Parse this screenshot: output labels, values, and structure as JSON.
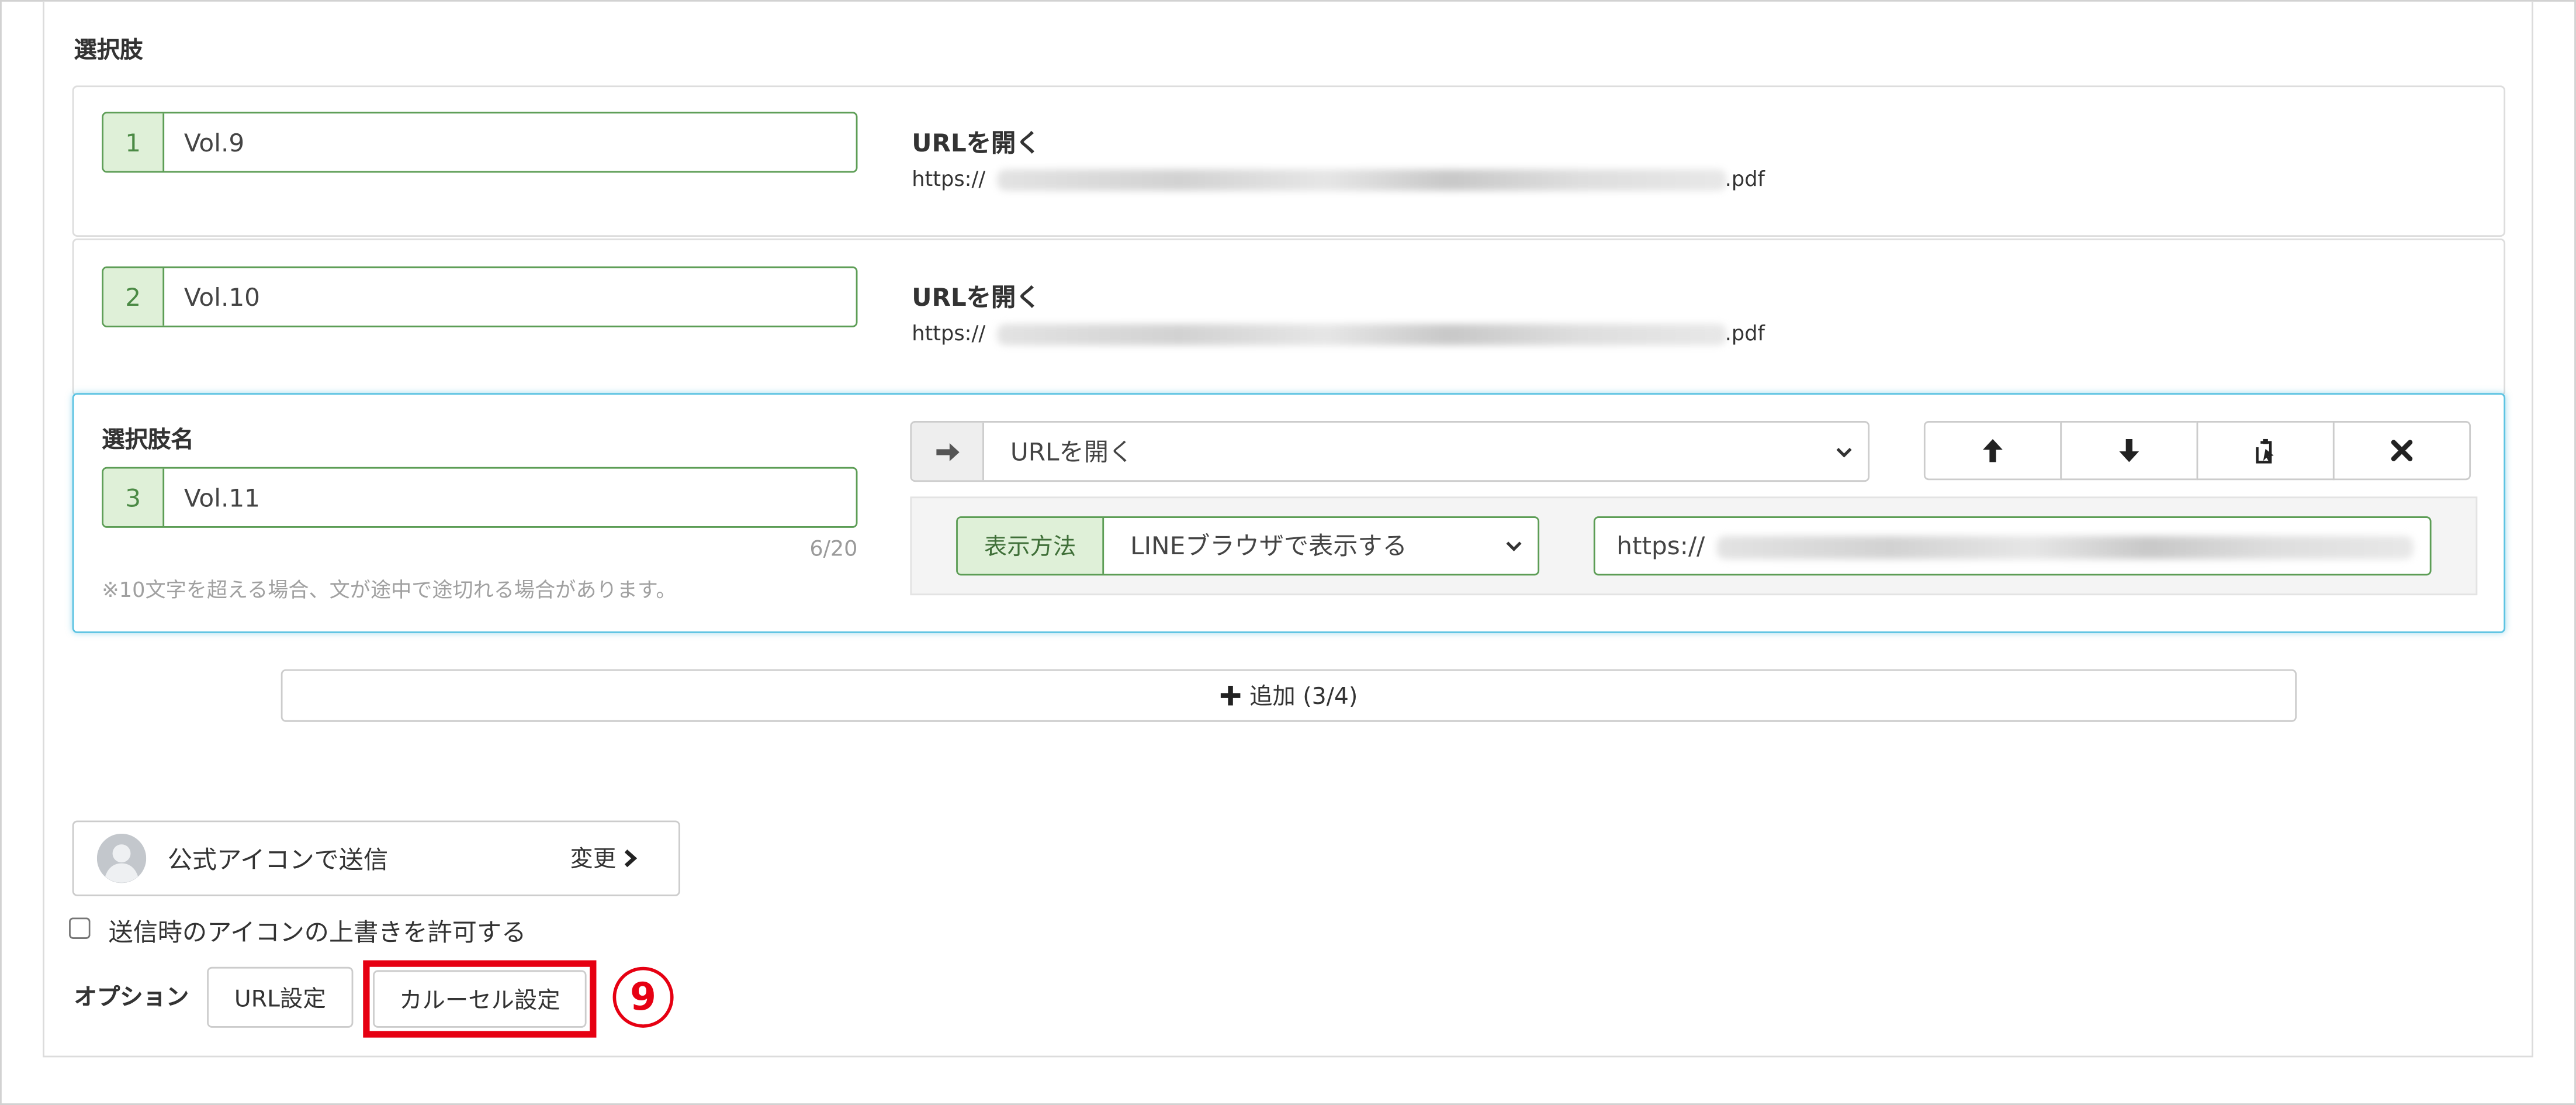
{
  "section_label": "選択肢",
  "choices": [
    {
      "index": "1",
      "label": "Vol.9",
      "action": "URLを開く",
      "url_prefix": "https://",
      "url_suffix": ".pdf"
    },
    {
      "index": "2",
      "label": "Vol.10",
      "action": "URLを開く",
      "url_prefix": "https://",
      "url_suffix": ".pdf"
    }
  ],
  "active_choice": {
    "field_label": "選択肢名",
    "index": "3",
    "label": "Vol.11",
    "char_count": "6/20",
    "hint": "※10文字を超える場合、文が途中で途切れる場合があります。",
    "action_select": {
      "value": "URLを開く"
    },
    "display_method": {
      "label": "表示方法",
      "value": "LINEブラウザで表示する"
    },
    "url_input": {
      "value_prefix": "https://"
    }
  },
  "add_button": {
    "label": "追加 (3/4)"
  },
  "sender": {
    "label": "公式アイコンで送信",
    "change_label": "変更"
  },
  "override_checkbox": {
    "label": "送信時のアイコンの上書きを許可する"
  },
  "options": {
    "label": "オプション",
    "url_button": "URL設定",
    "carousel_button": "カルーセル設定"
  },
  "annotation": {
    "number": "9"
  },
  "icons": {
    "action_addon": "arrow-right-icon",
    "move_up": "arrow-up-icon",
    "move_down": "arrow-down-icon",
    "copy": "paste-icon",
    "delete": "close-icon",
    "add": "plus-icon",
    "change": "chevron-right-icon",
    "avatar": "avatar-icon"
  },
  "colors": {
    "green_border": "#5c9d55",
    "green_addon_bg": "#dff0d8",
    "active_border": "#5cc3e2",
    "highlight_red": "#e60012"
  }
}
